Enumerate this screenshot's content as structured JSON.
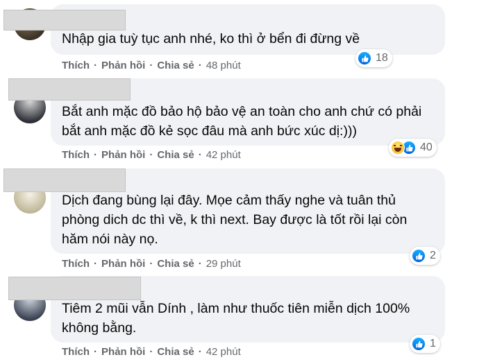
{
  "colors": {
    "bubble": "#f0f2f5",
    "meta": "#65676b",
    "text": "#050505",
    "like": "#0866ff"
  },
  "comments": [
    {
      "text": "Nhập gia tuỳ tục anh nhé, ko thì ở bển đi đừng về",
      "reaction_count": "18",
      "reactions": [
        "like-icon"
      ],
      "actions": {
        "like": "Thích",
        "reply": "Phản hồi",
        "share": "Chia sẻ",
        "time": "48 phút"
      }
    },
    {
      "text": "Bắt anh mặc đồ bảo hộ bảo vệ an toàn cho anh chứ có phải bắt anh mặc đồ kẻ sọc đâu mà anh bức xúc dị:)))",
      "reaction_count": "40",
      "reactions": [
        "haha-icon",
        "like-icon"
      ],
      "actions": {
        "like": "Thích",
        "reply": "Phản hồi",
        "share": "Chia sẻ",
        "time": "42 phút"
      }
    },
    {
      "text": "Dịch đang bùng lại đây. Mọe cảm thấy nghe và tuân thủ phòng dich dc thì về, k thì next. Bay được là tốt rồi lại còn hăm nói này nọ.",
      "reaction_count": "2",
      "reactions": [
        "like-icon"
      ],
      "actions": {
        "like": "Thích",
        "reply": "Phản hồi",
        "share": "Chia sẻ",
        "time": "29 phút"
      }
    },
    {
      "text": "Tiêm 2 mũi vẫn Dính , làm như thuốc tiên miễn dịch 100% không bằng.",
      "reaction_count": "1",
      "reactions": [
        "like-icon"
      ],
      "actions": {
        "like": "Thích",
        "reply": "Phản hồi",
        "share": "Chia sẻ",
        "time": "42 phút"
      }
    }
  ]
}
